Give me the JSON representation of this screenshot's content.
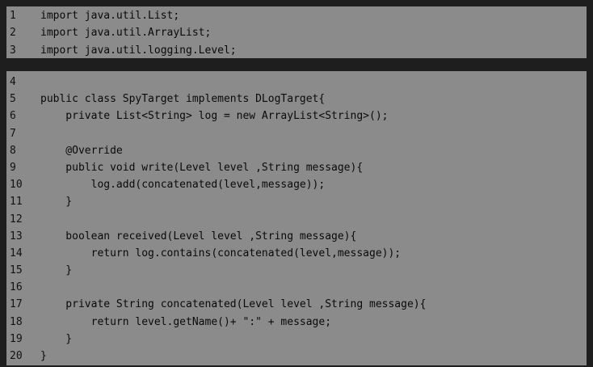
{
  "panels": [
    {
      "id": "imports",
      "lines": [
        {
          "num": "1",
          "text": "import java.util.List;"
        },
        {
          "num": "2",
          "text": "import java.util.ArrayList;"
        },
        {
          "num": "3",
          "text": "import java.util.logging.Level;"
        }
      ]
    },
    {
      "id": "class-body",
      "lines": [
        {
          "num": "4",
          "text": ""
        },
        {
          "num": "5",
          "text": "public class SpyTarget implements DLogTarget{"
        },
        {
          "num": "6",
          "text": "    private List<String> log = new ArrayList<String>();"
        },
        {
          "num": "7",
          "text": ""
        },
        {
          "num": "8",
          "text": "    @Override"
        },
        {
          "num": "9",
          "text": "    public void write(Level level ,String message){"
        },
        {
          "num": "10",
          "text": "        log.add(concatenated(level,message));"
        },
        {
          "num": "11",
          "text": "    }"
        },
        {
          "num": "12",
          "text": ""
        },
        {
          "num": "13",
          "text": "    boolean received(Level level ,String message){"
        },
        {
          "num": "14",
          "text": "        return log.contains(concatenated(level,message));"
        },
        {
          "num": "15",
          "text": "    }"
        },
        {
          "num": "16",
          "text": ""
        },
        {
          "num": "17",
          "text": "    private String concatenated(Level level ,String message){"
        },
        {
          "num": "18",
          "text": "        return level.getName()+ \":\" + message;"
        },
        {
          "num": "19",
          "text": "    }"
        },
        {
          "num": "20",
          "text": "}"
        }
      ]
    }
  ]
}
